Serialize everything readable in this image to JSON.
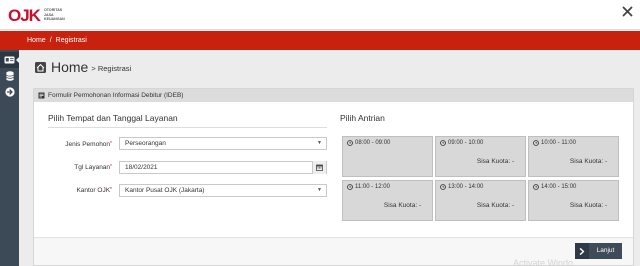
{
  "header": {
    "logo_mark": "OJK",
    "logo_text_line1": "OTORITAS",
    "logo_text_line2": "JASA",
    "logo_text_line3": "KEUANGAN",
    "close_icon": "close-icon"
  },
  "breadcrumb": {
    "home": "Home",
    "separator": "/",
    "current": "Registrasi"
  },
  "page": {
    "title": "Home",
    "subtitle": "> Registrasi"
  },
  "panel": {
    "title": "Formulir Permohonan Informasi Debitur (IDEB)"
  },
  "left_section": {
    "title": "Pilih Tempat dan Tanggal Layanan",
    "fields": {
      "jenis_label": "Jenis Pemohon",
      "jenis_value": "Perseorangan",
      "tgl_label": "Tgl Layanan",
      "tgl_value": "18/02/2021",
      "kantor_label": "Kantor OJK",
      "kantor_value": "Kantor Pusat OJK (Jakarta)",
      "required_mark": "*"
    }
  },
  "right_section": {
    "title": "Pilih Antrian",
    "slots": [
      {
        "time": "08:00 - 09:00",
        "quota": ""
      },
      {
        "time": "09:00 - 10:00",
        "quota": "Sisa Kuota: -"
      },
      {
        "time": "10:00 - 11:00",
        "quota": "Sisa Kuota: -"
      },
      {
        "time": "11:00 - 12:00",
        "quota": "Sisa Kuota: -"
      },
      {
        "time": "13:00 - 14:00",
        "quota": "Sisa Kuota: -"
      },
      {
        "time": "14:00 - 15:00",
        "quota": "Sisa Kuota: -"
      }
    ]
  },
  "footer": {
    "next_label": "Lanjut"
  },
  "watermark": "Activate Windo",
  "colors": {
    "brand_red": "#c8220f",
    "sidebar": "#3c4a57",
    "slot_bg": "#d8d8d8"
  }
}
